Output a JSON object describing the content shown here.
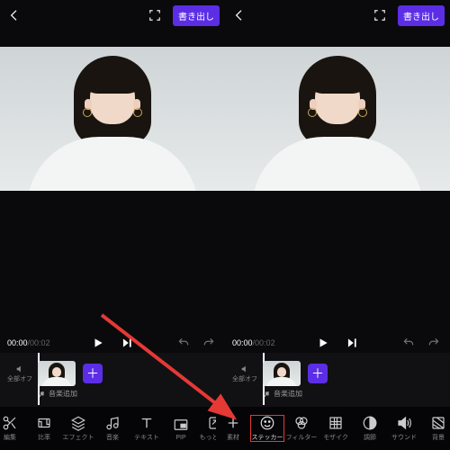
{
  "top": {
    "export_label": "書き出し"
  },
  "time": {
    "current": "00:00",
    "duration": "00:02"
  },
  "timeline": {
    "mute_label": "全部オフ",
    "music_add_label": "音楽追加"
  },
  "toolbar_left": {
    "items": [
      {
        "icon": "scissors-icon",
        "label": "編集"
      },
      {
        "icon": "ratio-icon",
        "label": "比率"
      },
      {
        "icon": "layers-icon",
        "label": "エフェクト"
      },
      {
        "icon": "music-note-icon",
        "label": "音楽"
      },
      {
        "icon": "text-icon",
        "label": "テキスト"
      },
      {
        "icon": "pip-icon",
        "label": "PIP"
      },
      {
        "icon": "more-icon",
        "label": "もっと見る"
      }
    ]
  },
  "toolbar_right": {
    "items": [
      {
        "icon": "plus-icon",
        "label": "素材"
      },
      {
        "icon": "sticker-icon",
        "label": "ステッカー"
      },
      {
        "icon": "filter-icon",
        "label": "フィルター"
      },
      {
        "icon": "mosaic-icon",
        "label": "モザイク"
      },
      {
        "icon": "adjust-icon",
        "label": "調節"
      },
      {
        "icon": "sound-icon",
        "label": "サウンド"
      },
      {
        "icon": "bg-icon",
        "label": "背景"
      }
    ]
  }
}
